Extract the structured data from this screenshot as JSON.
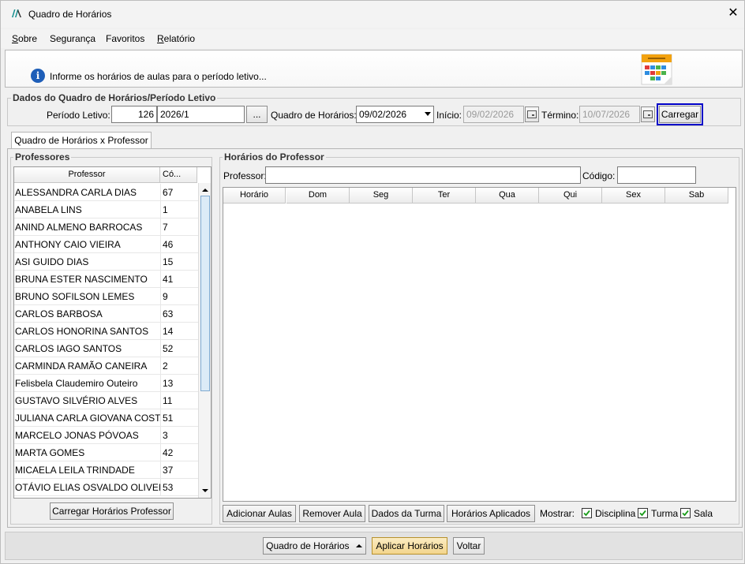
{
  "window": {
    "title": "Quadro de Horários",
    "app_icon": "ordinal-logo-icon",
    "close_icon": "close-icon"
  },
  "menu": {
    "items": [
      {
        "key": "S",
        "rest": "obre"
      },
      {
        "key": "",
        "rest": "Segurança"
      },
      {
        "key": "",
        "rest": "Favoritos"
      },
      {
        "key": "R",
        "rest": "elatório"
      }
    ]
  },
  "info": {
    "text": "Informe os horários de aulas para o período letivo...",
    "icon": "info-icon",
    "side_icon": "calendar-icon"
  },
  "periodo_group": {
    "title": "Dados do Quadro de Horários/Período Letivo",
    "periodo_label": "Período Letivo:",
    "periodo_code": "126",
    "periodo_name": "2026/1",
    "ellipsis": "...",
    "quadro_label": "Quadro de Horários:",
    "quadro_value": "09/02/2026",
    "inicio_label": "Início:",
    "inicio_value": "09/02/2026",
    "termino_label": "Término:",
    "termino_value": "10/07/2026",
    "carregar": "Carregar"
  },
  "tab": {
    "label": "Quadro de Horários x Professor"
  },
  "professores": {
    "title": "Professores",
    "columns": [
      "Professor",
      "Có..."
    ],
    "rows": [
      {
        "name": "ALESSANDRA CARLA DIAS",
        "code": "67"
      },
      {
        "name": "ANABELA LINS",
        "code": "1"
      },
      {
        "name": "ANIND ALMENO BARROCAS",
        "code": "7"
      },
      {
        "name": "ANTHONY CAIO VIEIRA",
        "code": "46"
      },
      {
        "name": "ASI GUIDO DIAS",
        "code": "15"
      },
      {
        "name": "BRUNA ESTER NASCIMENTO",
        "code": "41"
      },
      {
        "name": "BRUNO SOFILSON LEMES",
        "code": "9"
      },
      {
        "name": "CARLOS BARBOSA",
        "code": "63"
      },
      {
        "name": "CARLOS HONORINA SANTOS",
        "code": "14"
      },
      {
        "name": "CARLOS IAGO SANTOS",
        "code": "52"
      },
      {
        "name": "CARMINDA RAMÃO CANEIRA",
        "code": "2"
      },
      {
        "name": "Felisbela Claudemiro Outeiro",
        "code": "13"
      },
      {
        "name": "GUSTAVO SILVÉRIO ALVES",
        "code": "11"
      },
      {
        "name": "JULIANA CARLA GIOVANA COSTA",
        "code": "51"
      },
      {
        "name": "MARCELO JONAS PÓVOAS",
        "code": "3"
      },
      {
        "name": "MARTA GOMES",
        "code": "42"
      },
      {
        "name": "MICAELA LEILA TRINDADE",
        "code": "37"
      },
      {
        "name": "OTÁVIO ELIAS OSVALDO OLIVEIRA",
        "code": "53"
      }
    ],
    "load_button": "Carregar Horários Professor"
  },
  "horarios": {
    "title": "Horários do Professor",
    "professor_label": "Professor:",
    "professor_value": "",
    "codigo_label": "Código:",
    "codigo_value": "",
    "columns": [
      "Horário",
      "Dom",
      "Seg",
      "Ter",
      "Qua",
      "Qui",
      "Sex",
      "Sab"
    ],
    "buttons": [
      "Adicionar Aulas",
      "Remover Aula",
      "Dados da Turma",
      "Horários Aplicados"
    ],
    "mostrar_label": "Mostrar:",
    "checks": [
      {
        "label": "Disciplina",
        "checked": true
      },
      {
        "label": "Turma",
        "checked": true
      },
      {
        "label": "Sala",
        "checked": true
      }
    ]
  },
  "footer": {
    "quadro_btn": "Quadro de Horários",
    "quadro_icon": "caret-up-icon",
    "aplicar_btn": "Aplicar Horários",
    "voltar_btn": "Voltar"
  },
  "colors": {
    "focus_outline": "#0000c8",
    "info_blue": "#1e5eb8",
    "aplicar_bg": "#f3d58c"
  }
}
